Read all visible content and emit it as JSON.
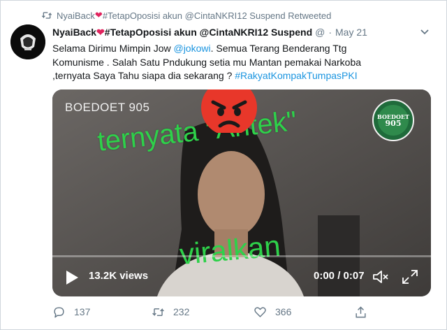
{
  "retweet": {
    "text_before": "NyaiBack",
    "text_after": "#TetapOposisi akun @CintaNKRI12 Suspend Retweeted"
  },
  "author": {
    "name_before": "NyaiBack",
    "name_after": "#TetapOposisi akun @CintaNKRI12 Suspend",
    "handle": "@",
    "separator": "·",
    "date": "May 21"
  },
  "tweet": {
    "line1": "Selama Dirimu Mimpin Jow ",
    "mention": "@jokowi",
    "line1_after": ". Semua Terang Benderang  Ttg",
    "line2": "Komunisme . Salah Satu Pndukung setia mu Mantan  pemakai Narkoba",
    "line3": ",ternyata  Saya Tahu  siapa dia  sekarang ? ",
    "hashtag": "#RakyatKompakTumpasPKI"
  },
  "video": {
    "watermark": "BOEDOET 905",
    "overlay_top": "ternyata \"Antek\"",
    "overlay_bottom": "viralkan",
    "badge_line1": "BOEDOET",
    "badge_line2": "905",
    "views": "13.2K views",
    "time": "0:00 / 0:07",
    "progress": 0
  },
  "actions": {
    "reply_count": "137",
    "retweet_count": "232",
    "like_count": "366"
  },
  "colors": {
    "link": "#1b95e0",
    "muted": "#657786",
    "overlay_green": "#2ed14a",
    "heart": "#e0245e"
  },
  "icons": [
    "retweet-icon",
    "heart-emoji-icon",
    "caret-down-icon",
    "play-icon",
    "volume-mute-icon",
    "fullscreen-icon",
    "reply-icon",
    "like-icon",
    "share-icon",
    "angry-face-icon"
  ]
}
